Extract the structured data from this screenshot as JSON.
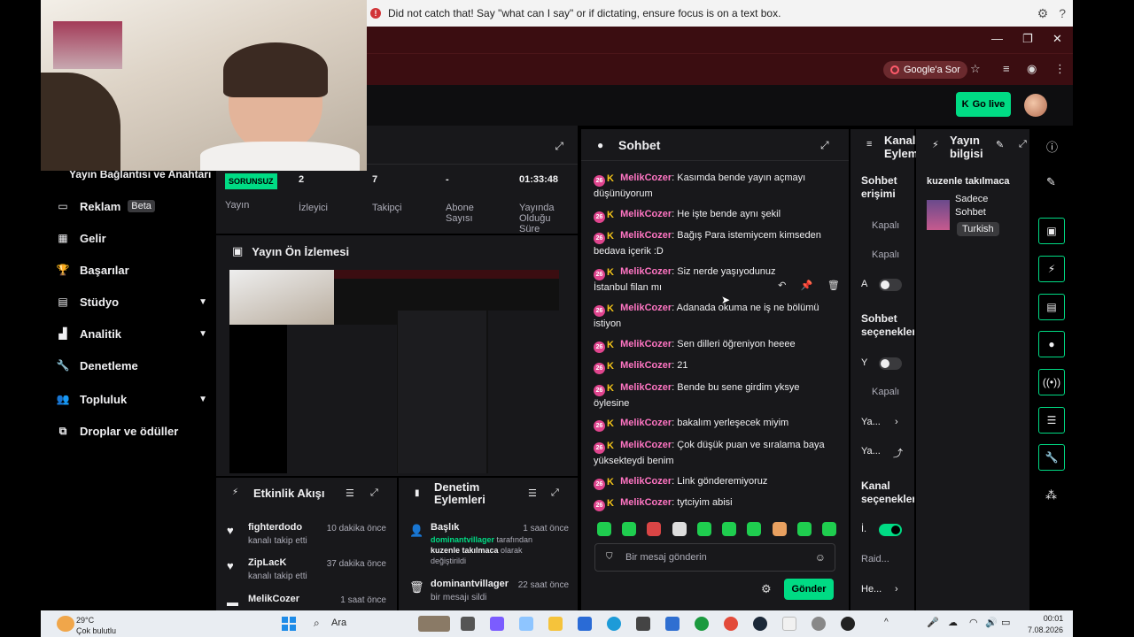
{
  "dictation": {
    "message": "Did not catch that! Say \"what can I say\" or if dictating, ensure focus is on a text box."
  },
  "browser": {
    "google_button": "Google'a Sor"
  },
  "topnav": {
    "go_live": "Go live"
  },
  "sidebar": {
    "cut_item": "Yayın Bağlantısı ve Anahtarı",
    "items": [
      {
        "label": "Reklam",
        "icon": "ad-icon",
        "badge": "Beta"
      },
      {
        "label": "Gelir",
        "icon": "revenue-icon"
      },
      {
        "label": "Başarılar",
        "icon": "trophy-icon"
      },
      {
        "label": "Stüdyo",
        "icon": "studio-icon"
      },
      {
        "label": "Analitik",
        "icon": "chart-icon"
      },
      {
        "label": "Denetleme",
        "icon": "wrench-icon"
      },
      {
        "label": "Topluluk",
        "icon": "community-icon"
      },
      {
        "label": "Droplar ve ödüller",
        "icon": "gift-icon"
      }
    ]
  },
  "stats": {
    "health": "SORUNSUZ",
    "health_label": "Yayın",
    "viewers": "2",
    "viewers_label": "İzleyici",
    "followers": "7",
    "followers_label": "Takipçi",
    "subs": "-",
    "subs_label": "Abone Sayısı",
    "uptime": "01:33:48",
    "uptime_label": "Yayında Olduğu Süre"
  },
  "preview": {
    "title": "Yayın Ön İzlemesi"
  },
  "activity": {
    "title": "Etkinlik Akışı",
    "items": [
      {
        "name": "fighterdodo",
        "sub": "kanalı takip etti",
        "time": "10 dakika önce"
      },
      {
        "name": "ZipLacK",
        "sub": "kanalı takip etti",
        "time": "37 dakika önce"
      },
      {
        "name": "MelikCozer",
        "sub": "",
        "time": "1 saat önce"
      }
    ]
  },
  "moderation": {
    "title": "Denetim Eylemleri",
    "items": [
      {
        "name": "Başlık",
        "line1": "dominantvillager",
        "line1b": " tarafından",
        "line2": "kuzenle takılmaca",
        "line2b": " olarak",
        "line3": "değiştirildi",
        "time": "1 saat önce"
      },
      {
        "name": "dominantvillager",
        "line1": "bir mesajı sildi",
        "time": "22 saat önce"
      }
    ]
  },
  "chat": {
    "title": "Sohbet",
    "badge_num": "26",
    "messages": [
      {
        "user": "MelikCozer",
        "text": ": Kasımda bende yayın açmayı düşünüyorum"
      },
      {
        "user": "MelikCozer",
        "text": ": He işte bende aynı şekil"
      },
      {
        "user": "MelikCozer",
        "text": ": Bağış Para istemiycem kimseden bedava içerik :D"
      },
      {
        "user": "MelikCozer",
        "text": ": Siz nerde yaşıyodunuz İstanbul filan mı"
      },
      {
        "user": "MelikCozer",
        "text": ": Adanada okuma ne iş ne bölümü istiyon"
      },
      {
        "user": "MelikCozer",
        "text": ": Sen dilleri öğreniyon heeee"
      },
      {
        "user": "MelikCozer",
        "text": ": 21"
      },
      {
        "user": "MelikCozer",
        "text": ": Bende bu sene girdim yksye öylesine"
      },
      {
        "user": "MelikCozer",
        "text": ": bakalım yerleşecek miyim"
      },
      {
        "user": "MelikCozer",
        "text": ": Çok düşük puan ve sıralama baya yüksekteydi benim"
      },
      {
        "user": "MelikCozer",
        "text": ": Link gönderemiyoruz"
      },
      {
        "user": "MelikCozer",
        "text": ": tytciyim abisi"
      }
    ],
    "input_placeholder": "Bir mesaj gönderin",
    "send": "Gönder"
  },
  "access": {
    "title": "Kanal Eylemleri",
    "chat_access": "Sohbet erişimi",
    "closed1": "Kapalı",
    "closed2": "Kapalı",
    "a_label": "A",
    "chat_options": "Sohbet seçenekleri",
    "y_label": "Y",
    "closed3": "Kapalı",
    "ya1": "Ya...",
    "ya2": "Ya...",
    "channel_options": "Kanal seçenekleri",
    "i_label": "İ.",
    "raid": "Raid...",
    "he": "He..."
  },
  "info": {
    "title": "Yayın bilgisi",
    "stream_title": "kuzenle takılmaca",
    "category": "Sadece Sohbet",
    "tag": "Turkish"
  },
  "taskbar": {
    "temp": "29°C",
    "weather": "Çok bulutlu",
    "search": "Ara",
    "time": "00:01",
    "date": "7.08.2026"
  }
}
